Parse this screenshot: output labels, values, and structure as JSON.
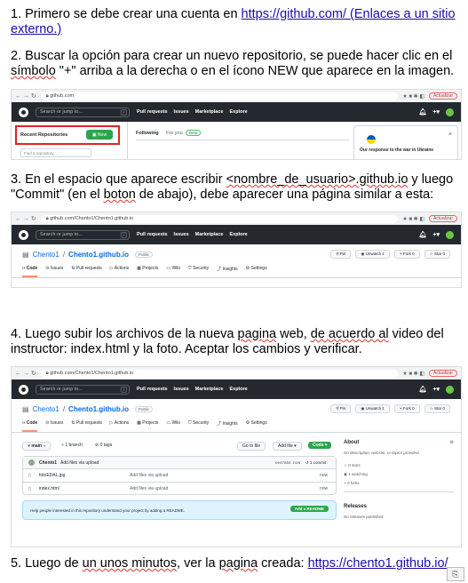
{
  "steps": {
    "s1_prefix": "1. Primero se debe crear una cuenta en ",
    "s1_link": "https://github.com/ (Enlaces a un sitio externo.)",
    "s2_a": "2. Buscar la opción para crear un nuevo repositorio, se puede hacer clic en el ",
    "s2_simbolo": "símbolo",
    "s2_b": " \"+\" arriba a la derecha o en el ícono NEW que aparece en la imagen.",
    "s3_a": "3. En el espacio que aparece escribir ",
    "s3_nombre": "<nombre_de_usuario>.github.io",
    "s3_b": " y luego \"Commit\" (en el ",
    "s3_boton": "boton",
    "s3_c": " de abajo), debe aparecer una página similar a esta:",
    "s4_a": "4. Luego subir los archivos de la nueva ",
    "s4_pagina": "pagina",
    "s4_b": " web, ",
    "s4_acuerdo": "de acuerdo al",
    "s4_c": " video del instructor: index.html y la foto. Aceptar los cambios y verificar.",
    "s5_a": "5. Luego de ",
    "s5_unos": "un unos minutos",
    "s5_b": ", ver la ",
    "s5_pagina": "pagina",
    "s5_c": " creada: ",
    "s5_link": "https://chento1.github.io/"
  },
  "browser": {
    "url1": "github.com",
    "url2": "github.com/Chento1/Chento1.github.io",
    "url3": "github.com/Chento1/Chento1.github.io",
    "update": "Actualizar"
  },
  "github": {
    "search": "Search or jump to...",
    "slash": "/",
    "nav": [
      "Pull requests",
      "Issues",
      "Marketplace",
      "Explore"
    ]
  },
  "dashboard": {
    "recent": "Recent Repositories",
    "new_btn": "New",
    "find": "Find a repository...",
    "following": "Following",
    "for_you": "For you",
    "beta": "Beta",
    "war": "Our response to the war in Ukraine"
  },
  "repo": {
    "owner": "Chento1",
    "sep": " / ",
    "name": "Chento1.github.io",
    "visibility": "Public",
    "pin": "Pin",
    "unwatch": "Unwatch",
    "unwatch_count": "1",
    "fork": "Fork",
    "fork_count": "0",
    "star": "Star",
    "star_count": "0",
    "tabs": [
      "Code",
      "Issues",
      "Pull requests",
      "Actions",
      "Projects",
      "Wiki",
      "Security",
      "Insights",
      "Settings"
    ]
  },
  "files": {
    "branch": "main",
    "branches": "1 branch",
    "tags": "0 tags",
    "goto": "Go to file",
    "add": "Add file",
    "code": "Code",
    "commit_user": "Chento1",
    "commit_msg": "Add files via upload",
    "commit_hash": "ee47a64",
    "commit_time": "now",
    "commits": "1 commit",
    "rows": [
      {
        "name": "fotoEDAL.jpg",
        "msg": "Add files via upload",
        "time": "now"
      },
      {
        "name": "index.html",
        "msg": "Add files via upload",
        "time": "now"
      }
    ],
    "readme_prompt": "Help people interested in this repository understand your project by adding a README.",
    "readme_btn": "Add a README",
    "about": "About",
    "about_desc": "No description, website, or topics provided.",
    "stars": "0 stars",
    "watching": "1 watching",
    "forks": "0 forks",
    "releases": "Releases",
    "no_releases": "No releases published"
  },
  "colors": {
    "link": "#1a0dab",
    "header": "#24292f",
    "green": "#2da44e",
    "highlight": "#e02424"
  }
}
